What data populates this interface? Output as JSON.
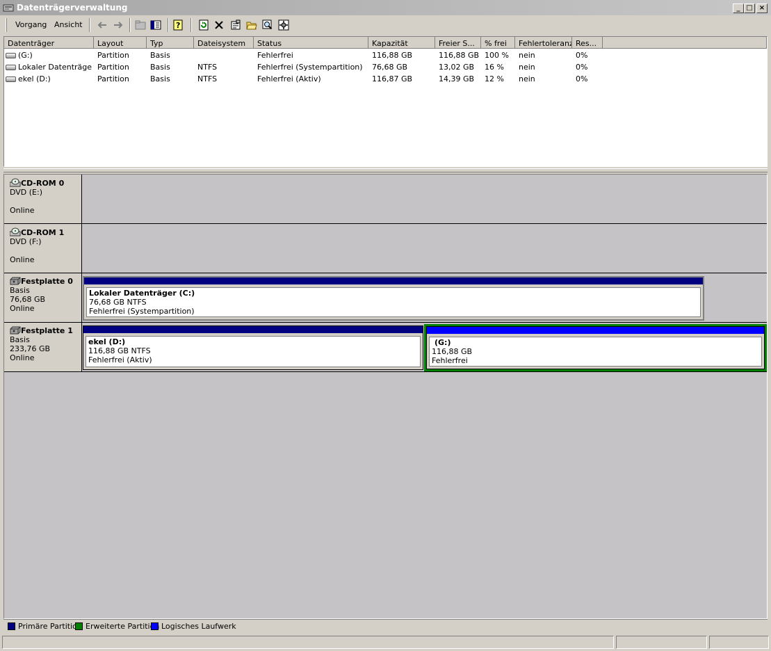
{
  "window": {
    "title": "Datenträgerverwaltung"
  },
  "menu": {
    "items": [
      "Vorgang",
      "Ansicht"
    ]
  },
  "list": {
    "columns": [
      "Datenträger",
      "Layout",
      "Typ",
      "Dateisystem",
      "Status",
      "Kapazität",
      "Freier S...",
      "% frei",
      "Fehlertoleranz",
      "Res..."
    ],
    "rows": [
      [
        "(G:)",
        "Partition",
        "Basis",
        "",
        "Fehlerfrei",
        "116,88 GB",
        "116,88 GB",
        "100 %",
        "nein",
        "0%"
      ],
      [
        "Lokaler Datenträge...",
        "Partition",
        "Basis",
        "NTFS",
        "Fehlerfrei (Systempartition)",
        "76,68 GB",
        "13,02 GB",
        "16 %",
        "nein",
        "0%"
      ],
      [
        "ekel (D:)",
        "Partition",
        "Basis",
        "NTFS",
        "Fehlerfrei (Aktiv)",
        "116,87 GB",
        "14,39 GB",
        "12 %",
        "nein",
        "0%"
      ]
    ]
  },
  "disks": [
    {
      "name": "CD-ROM 0",
      "line2": "DVD (E:)",
      "line3": "",
      "line4": "Online",
      "partitions": []
    },
    {
      "name": "CD-ROM 1",
      "line2": "DVD (F:)",
      "line3": "",
      "line4": "Online",
      "partitions": []
    },
    {
      "name": "Festplatte 0",
      "line2": "Basis",
      "line3": "76,68 GB",
      "line4": "Online",
      "partitions": [
        {
          "title": "Lokaler Datenträger  (C:)",
          "size": "76,68 GB NTFS",
          "status": "Fehlerfrei (Systempartition)",
          "kind": "primary"
        }
      ]
    },
    {
      "name": "Festplatte 1",
      "line2": "Basis",
      "line3": "233,76 GB",
      "line4": "Online",
      "partitions": [
        {
          "title": "ekel  (D:)",
          "size": "116,88 GB NTFS",
          "status": "Fehlerfrei (Aktiv)",
          "kind": "primary"
        },
        {
          "title": "(G:)",
          "size": "116,88 GB",
          "status": "Fehlerfrei",
          "kind": "logical"
        }
      ]
    }
  ],
  "legend": [
    {
      "label": "Primäre Partition",
      "color": "#000080"
    },
    {
      "label": "Erweiterte Partition",
      "color": "#008000"
    },
    {
      "label": "Logisches Laufwerk",
      "color": "#0000ff"
    }
  ],
  "colors": {
    "primary": "#000080",
    "extended": "#008000",
    "logical": "#0000ff"
  }
}
